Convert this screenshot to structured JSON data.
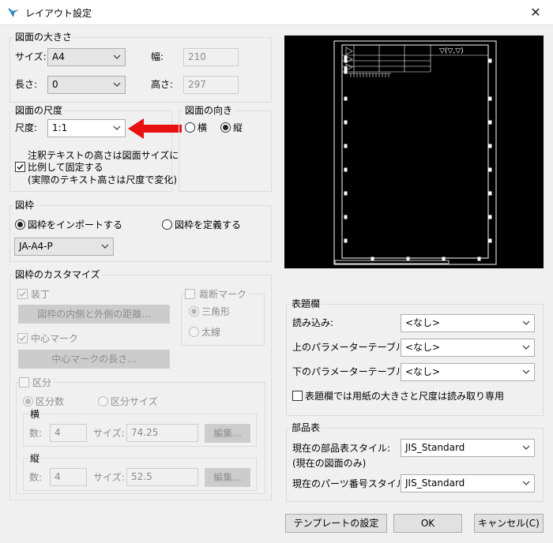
{
  "window": {
    "title": "レイアウト設定",
    "close_glyph": "✕"
  },
  "paper_size": {
    "legend": "図面の大きさ",
    "size_label": "サイズ:",
    "size_value": "A4",
    "width_label": "幅:",
    "width_value": "210",
    "length_label": "長さ:",
    "length_value": "0",
    "height_label": "高さ:",
    "height_value": "297"
  },
  "scale": {
    "legend": "図面の尺度",
    "scale_label": "尺度:",
    "scale_value": "1:1",
    "fixed_text_line1": "注釈テキストの高さは図面サイズに",
    "fixed_text_line2": "比例して固定する",
    "fixed_text_line3": "(実際のテキスト高さは尺度で変化)"
  },
  "orientation": {
    "legend": "図面の向き",
    "landscape": "横",
    "portrait": "縦"
  },
  "frame": {
    "legend": "図枠",
    "import_option": "図枠をインポートする",
    "define_option": "図枠を定義する",
    "frame_value": "JA-A4-P"
  },
  "customize": {
    "legend": "図枠のカスタマイズ",
    "binding": "装丁",
    "binding_button": "図枠の内側と外側の距離...",
    "center_mark": "中心マーク",
    "center_mark_button": "中心マークの長さ...",
    "trim_mark": "裁断マーク",
    "triangle": "三角形",
    "line": "太線",
    "zone": "区分",
    "zone_count": "区分数",
    "zone_size": "区分サイズ",
    "horizontal": "横",
    "vertical": "縦",
    "count_label": "数:",
    "size_label": "サイズ:",
    "h_count": "4",
    "h_size": "74.25",
    "v_count": "4",
    "v_size": "52.5",
    "edit_button": "編集..."
  },
  "title_block": {
    "legend": "表題欄",
    "read_label": "読み込み:",
    "upper_table_label": "上のパラメーターテーブル:",
    "lower_table_label": "下のパラメーターテーブル:",
    "none_value": "<なし>",
    "readonly_label": "表題欄では用紙の大きさと尺度は読み取り専用"
  },
  "parts_list": {
    "legend": "部品表",
    "bom_style_label": "現在の部品表スタイル:",
    "bom_style_note": "(現在の図面のみ)",
    "bom_style_value": "JIS_Standard",
    "part_number_label": "現在のパーツ番号スタイル:",
    "part_number_value": "JIS_Standard"
  },
  "buttons": {
    "template": "テンプレートの設定",
    "ok": "OK",
    "cancel": "キャンセル(C)"
  },
  "preview": {
    "title_symbol": "▽(▽,▽)"
  },
  "colors": {
    "arrow": "#e81010",
    "preview_bg": "#000000",
    "preview_line": "#ffffff"
  }
}
